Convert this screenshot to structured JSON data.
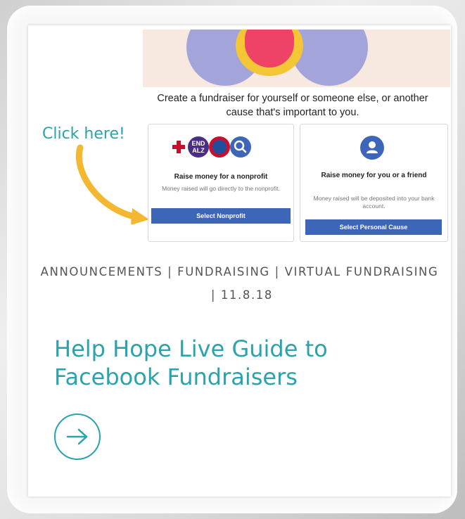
{
  "fundraiser_panel": {
    "intro_text": "Create a fundraiser for yourself or someone else, or another cause that's important to you.",
    "click_hint": "Click here!",
    "nonprofit": {
      "logo_end_alz": "END ALZ",
      "title": "Raise money for a nonprofit",
      "description": "Money raised will go directly to the nonprofit.",
      "button_label": "Select Nonprofit"
    },
    "personal": {
      "title": "Raise money for you or a friend",
      "description": "Money raised will be deposited into your bank account.",
      "button_label": "Select Personal Cause"
    }
  },
  "post": {
    "categories": [
      "ANNOUNCEMENTS",
      "FUNDRAISING",
      "VIRTUAL FUNDRAISING"
    ],
    "separator": " | ",
    "date": "11.8.18",
    "title": "Help Hope Live Guide to Facebook Fundraisers",
    "read_more_icon": "arrow-right-circle-icon"
  },
  "colors": {
    "accent_teal": "#2aa3ad",
    "facebook_blue": "#3d66b8",
    "arrow_yellow": "#f3b82f"
  }
}
